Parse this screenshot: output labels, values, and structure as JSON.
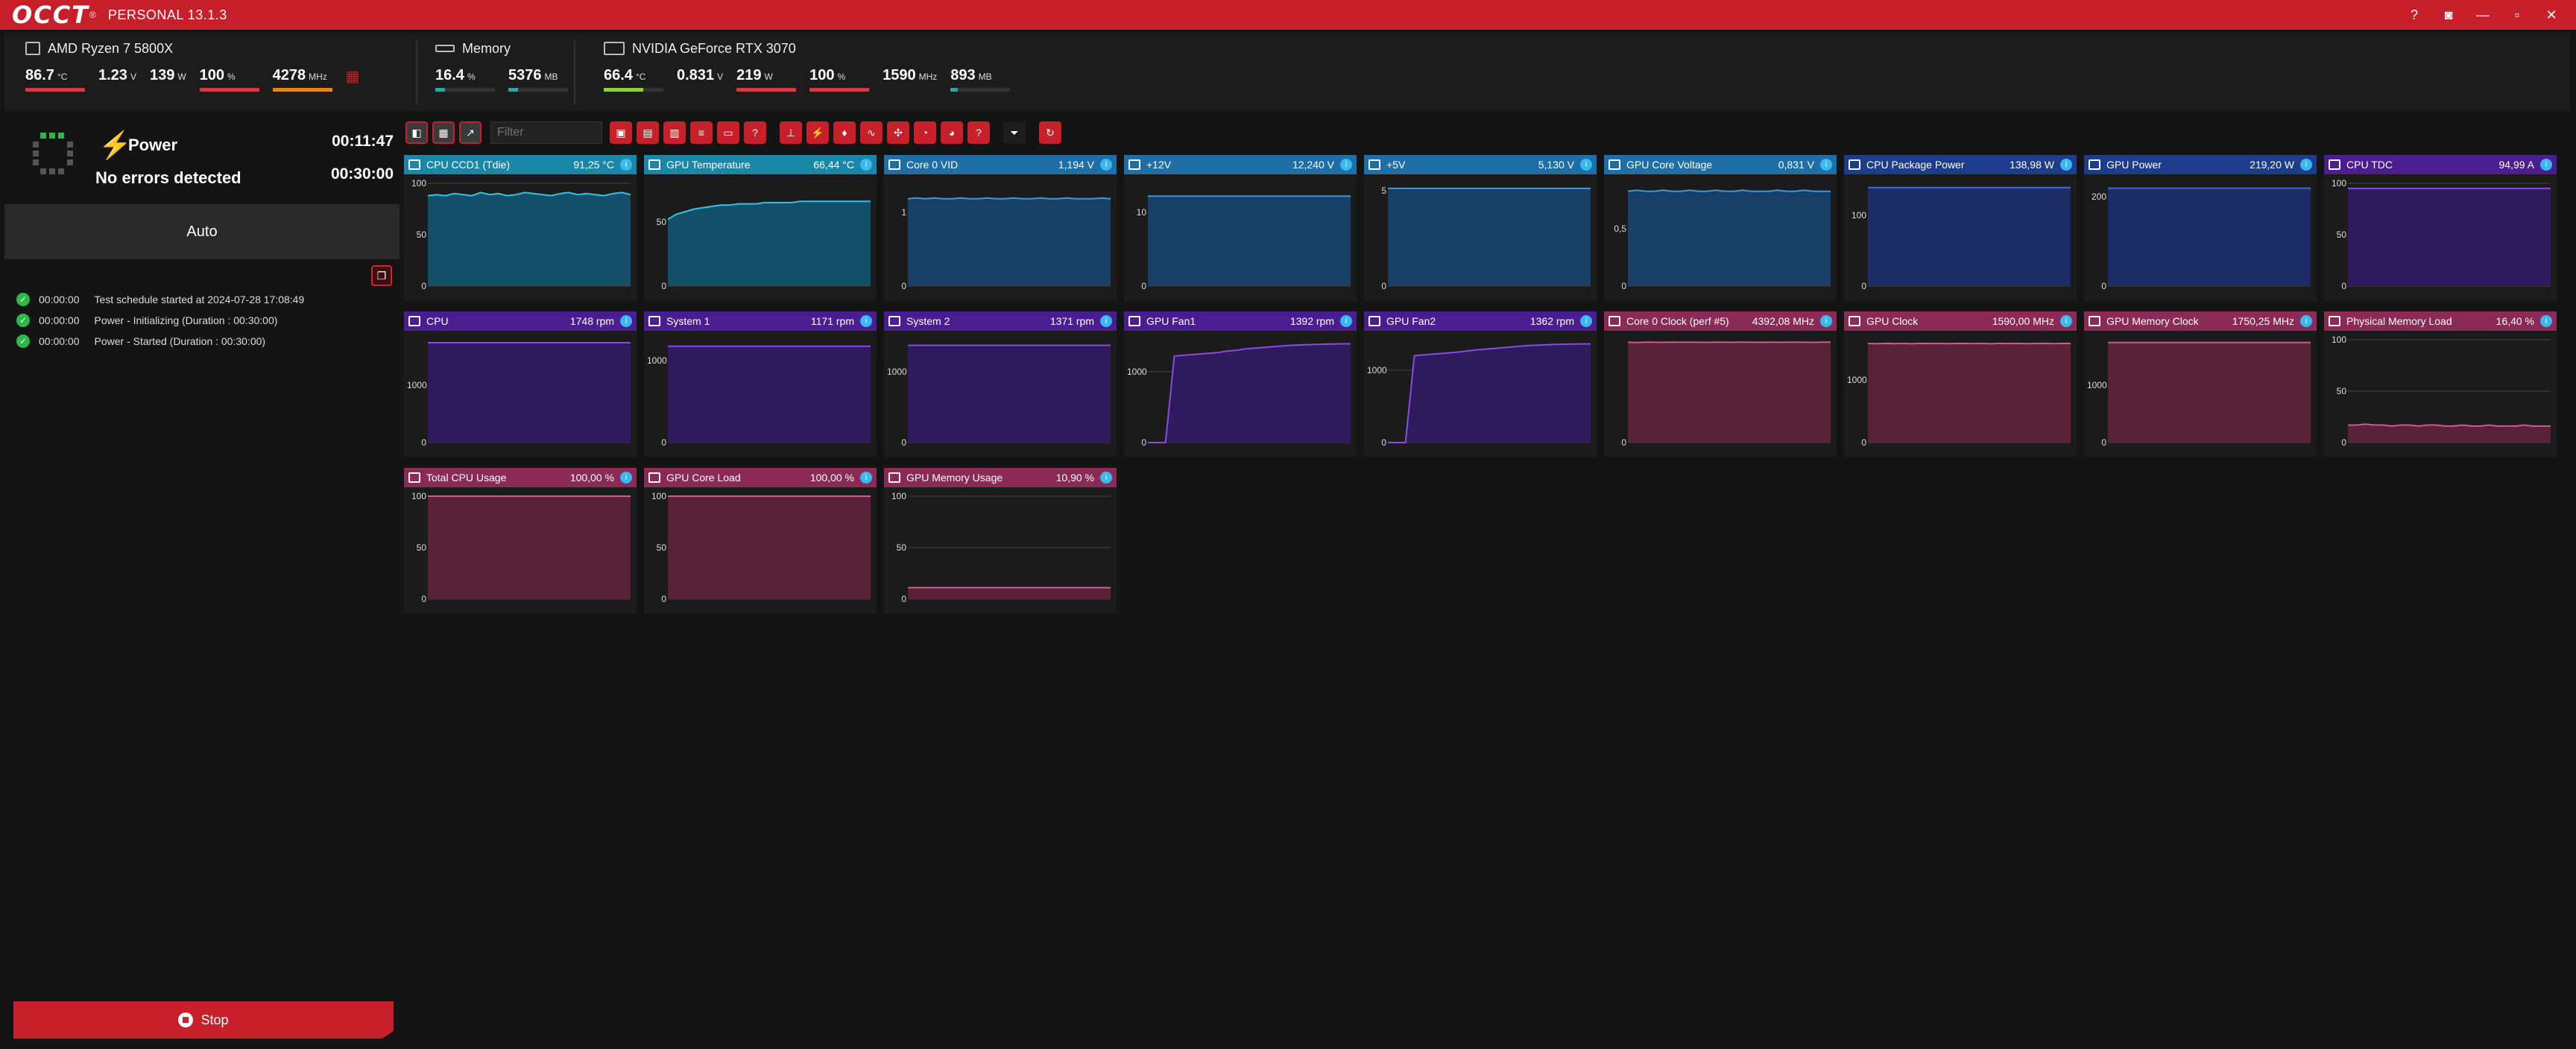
{
  "app": {
    "logo": "OCCT",
    "edition": "PERSONAL 13.1.3"
  },
  "window_controls": {
    "help": "?",
    "screenshot": "◙",
    "minimize": "—",
    "restore": "▫",
    "close": "✕"
  },
  "monitors": {
    "cpu": {
      "name": "AMD Ryzen 7 5800X",
      "temp": "86.7",
      "temp_unit": "°C",
      "voltage": "1.23",
      "voltage_unit": "V",
      "power": "139",
      "power_unit": "W",
      "load": "100",
      "load_unit": "%",
      "clock": "4278",
      "clock_unit": "MHz"
    },
    "memory": {
      "name": "Memory",
      "usage": "16.4",
      "usage_unit": "%",
      "used": "5376",
      "used_unit": "MB"
    },
    "gpu": {
      "name": "NVIDIA GeForce RTX 3070",
      "temp": "66.4",
      "temp_unit": "°C",
      "voltage": "0.831",
      "voltage_unit": "V",
      "power": "219",
      "power_unit": "W",
      "load": "100",
      "load_unit": "%",
      "clock": "1590",
      "clock_unit": "MHz",
      "mem": "893",
      "mem_unit": "MB"
    }
  },
  "test": {
    "name": "Power",
    "status": "No errors detected",
    "elapsed": "00:11:47",
    "duration": "00:30:00",
    "mode": "Auto"
  },
  "log": [
    {
      "time": "00:00:00",
      "msg": "Test schedule started at 2024-07-28 17:08:49"
    },
    {
      "time": "00:00:00",
      "msg": "Power - Initializing (Duration : 00:30:00)"
    },
    {
      "time": "00:00:00",
      "msg": "Power - Started (Duration : 00:30:00)"
    }
  ],
  "stop_label": "Stop",
  "filter": {
    "placeholder": "Filter"
  },
  "colors": {
    "accent": "#c8202a",
    "blue_header": "#1e6ea8",
    "cyan_header": "#1a86a8",
    "navy_header": "#1e3c8c",
    "purple_header": "#4a1e90",
    "pink_header": "#8a2a55",
    "ok": "#2fb84a"
  },
  "cards": [
    {
      "title": "CPU CCD1 (Tdie)",
      "value": "91,25 °C",
      "icon": "thermometer-icon",
      "theme": "cyan",
      "ticks": [
        "100",
        "50",
        "0"
      ],
      "ymax": 100,
      "series": [
        88,
        89,
        88,
        90,
        89,
        88,
        91,
        89,
        90,
        88,
        89,
        91,
        90,
        89,
        88,
        90,
        91,
        89,
        90,
        89,
        88,
        90,
        91,
        89
      ]
    },
    {
      "title": "GPU Temperature",
      "value": "66,44 °C",
      "icon": "thermometer-icon",
      "theme": "cyan",
      "ticks": [
        "50",
        "0"
      ],
      "ymax": 80,
      "series": [
        52,
        56,
        58,
        60,
        61,
        62,
        63,
        63,
        64,
        64,
        64,
        65,
        65,
        65,
        65,
        66,
        66,
        66,
        66,
        66,
        66,
        66,
        66,
        66
      ]
    },
    {
      "title": "Core 0 VID",
      "value": "1,194 V",
      "icon": "chip-icon",
      "theme": "blue",
      "ticks": [
        "1",
        "0"
      ],
      "ymax": 1.4,
      "series": [
        1.19,
        1.2,
        1.19,
        1.2,
        1.19,
        1.19,
        1.2,
        1.19,
        1.19,
        1.2,
        1.19,
        1.19,
        1.2,
        1.19,
        1.19,
        1.2,
        1.19,
        1.19,
        1.2,
        1.19,
        1.19,
        1.19,
        1.2,
        1.19
      ]
    },
    {
      "title": "+12V",
      "value": "12,240 V",
      "icon": "plug-icon",
      "theme": "blue",
      "ticks": [
        "10",
        "0"
      ],
      "ymax": 14,
      "series": [
        12.24,
        12.24,
        12.24,
        12.24,
        12.24,
        12.24,
        12.24,
        12.24,
        12.24,
        12.24,
        12.24,
        12.24,
        12.24,
        12.24,
        12.24,
        12.24,
        12.24,
        12.24,
        12.24,
        12.24,
        12.24,
        12.24,
        12.24,
        12.24
      ]
    },
    {
      "title": "+5V",
      "value": "5,130 V",
      "icon": "plug-icon",
      "theme": "blue",
      "ticks": [
        "5",
        "0"
      ],
      "ymax": 5.4,
      "series": [
        5.13,
        5.13,
        5.13,
        5.13,
        5.13,
        5.13,
        5.13,
        5.13,
        5.13,
        5.13,
        5.13,
        5.13,
        5.13,
        5.13,
        5.13,
        5.13,
        5.13,
        5.13,
        5.13,
        5.13,
        5.13,
        5.13,
        5.13,
        5.13
      ]
    },
    {
      "title": "GPU Core Voltage",
      "value": "0,831 V",
      "icon": "plug-icon",
      "theme": "blue",
      "ticks": [
        "0,5",
        "0"
      ],
      "ymax": 0.9,
      "series": [
        0.83,
        0.84,
        0.83,
        0.83,
        0.84,
        0.83,
        0.83,
        0.84,
        0.83,
        0.83,
        0.84,
        0.83,
        0.83,
        0.84,
        0.83,
        0.83,
        0.83,
        0.84,
        0.83,
        0.83,
        0.84,
        0.83,
        0.83,
        0.83
      ]
    },
    {
      "title": "CPU Package Power",
      "value": "138,98 W",
      "icon": "plug-icon",
      "theme": "navy",
      "ticks": [
        "100",
        "0"
      ],
      "ymax": 145,
      "series": [
        139,
        139,
        139,
        139,
        139,
        139,
        139,
        139,
        139,
        139,
        139,
        139,
        139,
        139,
        139,
        139,
        139,
        139,
        139,
        139,
        139,
        139,
        139,
        139
      ]
    },
    {
      "title": "GPU Power",
      "value": "219,20 W",
      "icon": "plug-icon",
      "theme": "navy",
      "ticks": [
        "200",
        "0"
      ],
      "ymax": 230,
      "series": [
        219,
        219,
        219,
        219,
        219,
        219,
        219,
        219,
        219,
        219,
        219,
        219,
        219,
        219,
        219,
        219,
        219,
        219,
        219,
        219,
        219,
        219,
        219,
        219
      ]
    },
    {
      "title": "CPU TDC",
      "value": "94,99 A",
      "icon": "chip-icon",
      "theme": "purple",
      "ticks": [
        "100",
        "50",
        "0"
      ],
      "ymax": 100,
      "series": [
        95,
        95,
        95,
        95,
        95,
        95,
        95,
        95,
        95,
        95,
        95,
        95,
        95,
        95,
        95,
        95,
        95,
        95,
        95,
        95,
        95,
        95,
        95,
        95
      ]
    },
    {
      "title": "CPU",
      "value": "1748 rpm",
      "icon": "fan-icon",
      "theme": "purple",
      "ticks": [
        "1000",
        "0"
      ],
      "ymax": 1800,
      "series": [
        1748,
        1748,
        1748,
        1748,
        1748,
        1748,
        1748,
        1748,
        1748,
        1748,
        1748,
        1748,
        1748,
        1748,
        1748,
        1748,
        1748,
        1748,
        1748,
        1748,
        1748,
        1748,
        1748,
        1748
      ]
    },
    {
      "title": "System 1",
      "value": "1171 rpm",
      "icon": "fan-icon",
      "theme": "purple",
      "ticks": [
        "1000",
        "0"
      ],
      "ymax": 1250,
      "series": [
        1171,
        1171,
        1171,
        1171,
        1171,
        1171,
        1171,
        1171,
        1171,
        1171,
        1171,
        1171,
        1171,
        1171,
        1171,
        1171,
        1171,
        1171,
        1171,
        1171,
        1171,
        1171,
        1171,
        1171
      ]
    },
    {
      "title": "System 2",
      "value": "1371 rpm",
      "icon": "fan-icon",
      "theme": "purple",
      "ticks": [
        "1000",
        "0"
      ],
      "ymax": 1450,
      "series": [
        1371,
        1371,
        1371,
        1371,
        1371,
        1371,
        1371,
        1371,
        1371,
        1371,
        1371,
        1371,
        1371,
        1371,
        1371,
        1371,
        1371,
        1371,
        1371,
        1371,
        1371,
        1371,
        1371,
        1371
      ]
    },
    {
      "title": "GPU Fan1",
      "value": "1392 rpm",
      "icon": "fan-icon",
      "theme": "purple",
      "ticks": [
        "1000",
        "0"
      ],
      "ymax": 1450,
      "series": [
        0,
        0,
        0,
        1220,
        1230,
        1240,
        1250,
        1260,
        1270,
        1290,
        1300,
        1320,
        1330,
        1340,
        1350,
        1360,
        1370,
        1375,
        1380,
        1385,
        1388,
        1390,
        1392,
        1392
      ]
    },
    {
      "title": "GPU Fan2",
      "value": "1362 rpm",
      "icon": "fan-icon",
      "theme": "purple",
      "ticks": [
        "1000",
        "0"
      ],
      "ymax": 1420,
      "series": [
        0,
        0,
        0,
        1200,
        1210,
        1220,
        1230,
        1240,
        1250,
        1265,
        1280,
        1290,
        1300,
        1310,
        1320,
        1330,
        1340,
        1345,
        1350,
        1355,
        1358,
        1360,
        1362,
        1362
      ]
    },
    {
      "title": "Core 0 Clock (perf #5)",
      "value": "4392,08 MHz",
      "icon": "gauge-icon",
      "theme": "pink",
      "ticks": [
        "0"
      ],
      "ymax": 4500,
      "series": [
        4392,
        4380,
        4395,
        4390,
        4385,
        4392,
        4388,
        4394,
        4390,
        4386,
        4392,
        4390,
        4388,
        4394,
        4390,
        4386,
        4392,
        4390,
        4388,
        4394,
        4390,
        4386,
        4392,
        4392
      ]
    },
    {
      "title": "GPU Clock",
      "value": "1590,00 MHz",
      "icon": "gauge-icon",
      "theme": "pink",
      "ticks": [
        "1000",
        "0"
      ],
      "ymax": 1650,
      "series": [
        1590,
        1585,
        1592,
        1588,
        1590,
        1586,
        1591,
        1589,
        1590,
        1587,
        1590,
        1592,
        1588,
        1590,
        1586,
        1591,
        1589,
        1590,
        1587,
        1590,
        1592,
        1588,
        1590,
        1590
      ]
    },
    {
      "title": "GPU Memory Clock",
      "value": "1750,25 MHz",
      "icon": "gauge-icon",
      "theme": "pink",
      "ticks": [
        "1000",
        "0"
      ],
      "ymax": 1800,
      "series": [
        1750,
        1750,
        1750,
        1750,
        1750,
        1750,
        1750,
        1750,
        1750,
        1750,
        1750,
        1750,
        1750,
        1750,
        1750,
        1750,
        1750,
        1750,
        1750,
        1750,
        1750,
        1750,
        1750,
        1750
      ]
    },
    {
      "title": "Physical Memory Load",
      "value": "16,40 %",
      "icon": "gauge-icon",
      "theme": "pink",
      "ticks": [
        "100",
        "50",
        "0"
      ],
      "ymax": 100,
      "series": [
        17,
        17,
        18,
        17,
        17,
        16,
        17,
        17,
        16,
        17,
        17,
        16,
        16,
        17,
        16,
        16,
        17,
        16,
        16,
        16,
        17,
        16,
        16,
        16
      ]
    },
    {
      "title": "Total CPU Usage",
      "value": "100,00 %",
      "icon": "gauge-icon",
      "theme": "pink",
      "ticks": [
        "100",
        "50",
        "0"
      ],
      "ymax": 100,
      "series": [
        100,
        100,
        100,
        100,
        100,
        100,
        100,
        100,
        100,
        100,
        100,
        100,
        100,
        100,
        100,
        100,
        100,
        100,
        100,
        100,
        100,
        100,
        100,
        100
      ]
    },
    {
      "title": "GPU Core Load",
      "value": "100,00 %",
      "icon": "gauge-icon",
      "theme": "pink",
      "ticks": [
        "100",
        "50",
        "0"
      ],
      "ymax": 100,
      "series": [
        100,
        100,
        100,
        100,
        100,
        100,
        100,
        100,
        100,
        100,
        100,
        100,
        100,
        100,
        100,
        100,
        100,
        100,
        100,
        100,
        100,
        100,
        100,
        100
      ]
    },
    {
      "title": "GPU Memory Usage",
      "value": "10,90 %",
      "icon": "gauge-icon",
      "theme": "pink",
      "ticks": [
        "100",
        "50",
        "0"
      ],
      "ymax": 100,
      "series": [
        11,
        11,
        11,
        11,
        11,
        11,
        11,
        11,
        11,
        11,
        11,
        11,
        11,
        11,
        11,
        11,
        11,
        11,
        11,
        11,
        11,
        11,
        11,
        11
      ]
    }
  ]
}
